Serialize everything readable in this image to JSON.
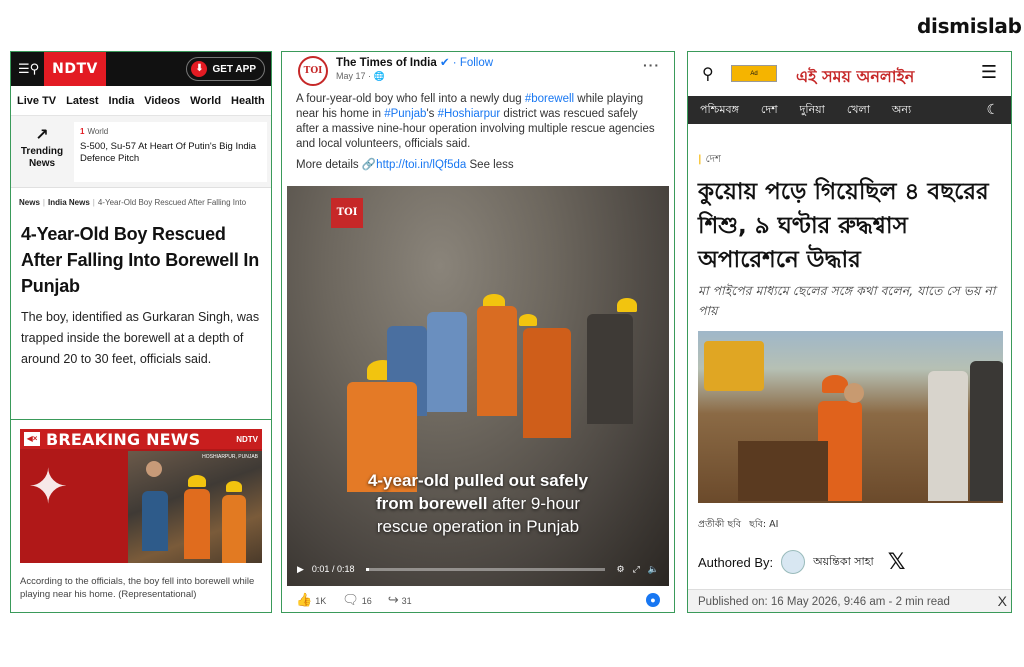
{
  "brand": "dismislab",
  "ndtv": {
    "menu_icon": "search-menu-icon",
    "logo": "NDTV",
    "get_app": "GET APP",
    "nav": [
      "Live TV",
      "Latest",
      "India",
      "Videos",
      "World",
      "Health"
    ],
    "trending_label": "Trending News",
    "trending_rank": "1",
    "trending_category": "World",
    "trending_text": "S-500, Su-57 At Heart Of Putin's Big India Defence Pitch",
    "breadcrumb": [
      "News",
      "India News",
      "4-Year-Old Boy Rescued After Falling Into"
    ],
    "headline": "4-Year-Old Boy Rescued After Falling Into Borewell In Punjab",
    "body": "The boy, identified as Gurkaran Singh, was trapped inside the borewell at a depth of around 20 to 30 feet, officials said.",
    "breaking_news": "BREAKING NEWS",
    "breaking_logo": "NDTV",
    "breaking_location": "HOSHIARPUR, PUNJAB",
    "caption": "According to the officials, the boy fell into borewell while playing near his home. (Representational)"
  },
  "toi": {
    "page_name": "The Times of India",
    "follow": "Follow",
    "date": "May 17",
    "avatar": "TOI",
    "post_text_1": "A four-year-old boy who fell into a newly dug ",
    "tag_borewell": "#borewell",
    "post_text_2": " while playing near his home in ",
    "tag_punjab": "#Punjab",
    "post_text_3": "'s ",
    "tag_hoshiarpur": "#Hoshiarpur",
    "post_text_4": " district was rescued safely after a massive nine-hour operation involving multiple rescue agencies and local volunteers, officials said.",
    "more_details": "More details ",
    "link": "http://toi.in/lQf5da",
    "see_less": " See less",
    "video_badge": "TOI",
    "video_caption_line1": "4-year-old pulled out safely",
    "video_caption_line2a": "from borewell",
    "video_caption_line2b": " after 9-hour",
    "video_caption_line3": "rescue operation in Punjab",
    "video_time": "0:01 / 0:18",
    "video_progress": 0.012,
    "likes": "1K",
    "comments": "16",
    "shares": "31"
  },
  "bengali": {
    "site_name": "এই সময় অনলাইন",
    "ad_label": "Ad",
    "nav": [
      "পশ্চিমবঙ্গ",
      "দেশ",
      "দুনিয়া",
      "খেলা",
      "অন্য"
    ],
    "section": "দেশ",
    "headline": "কুয়োয় পড়ে গিয়েছিল ৪ বছরের শিশু, ৯ ঘণ্টার রুদ্ধশ্বাস অপারেশনে উদ্ধার",
    "subhead": "মা পাইপের মাধ্যমে ছেলের সঙ্গে কথা বলেন, যাতে সে ভয় না পায়",
    "image_label": "প্রতীকী ছবি",
    "image_credit": "ছবি: AI",
    "authored_by": "Authored By:",
    "author_name": "অয়ন্তিকা সাহা",
    "published": "Published on: 16 May 2026, 9:46 am",
    "read_time": "2 min read"
  }
}
